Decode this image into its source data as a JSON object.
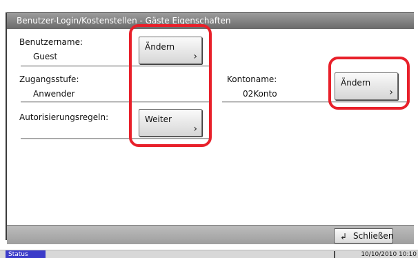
{
  "title": "Benutzer-Login/Kostenstellen - Gäste Eigenschaften",
  "fields": {
    "username": {
      "label": "Benutzername:",
      "value": "Guest",
      "button": "Ändern"
    },
    "access_level": {
      "label": "Zugangsstufe:",
      "value": "Anwender"
    },
    "account_name": {
      "label": "Kontoname:",
      "value": "02Konto",
      "button": "Ändern"
    },
    "auth_rules": {
      "label": "Autorisierungsregeln:",
      "button": "Weiter"
    }
  },
  "chevron": "›",
  "bottom": {
    "close_label": "Schließen",
    "close_icon": "↲"
  },
  "status_bar": {
    "status_label": "Status",
    "datetime": "10/10/2010  10:10"
  },
  "colors": {
    "highlight": "#e8202a",
    "status_tab": "#3b3bc9",
    "title_bar": "#7a7a7a"
  }
}
